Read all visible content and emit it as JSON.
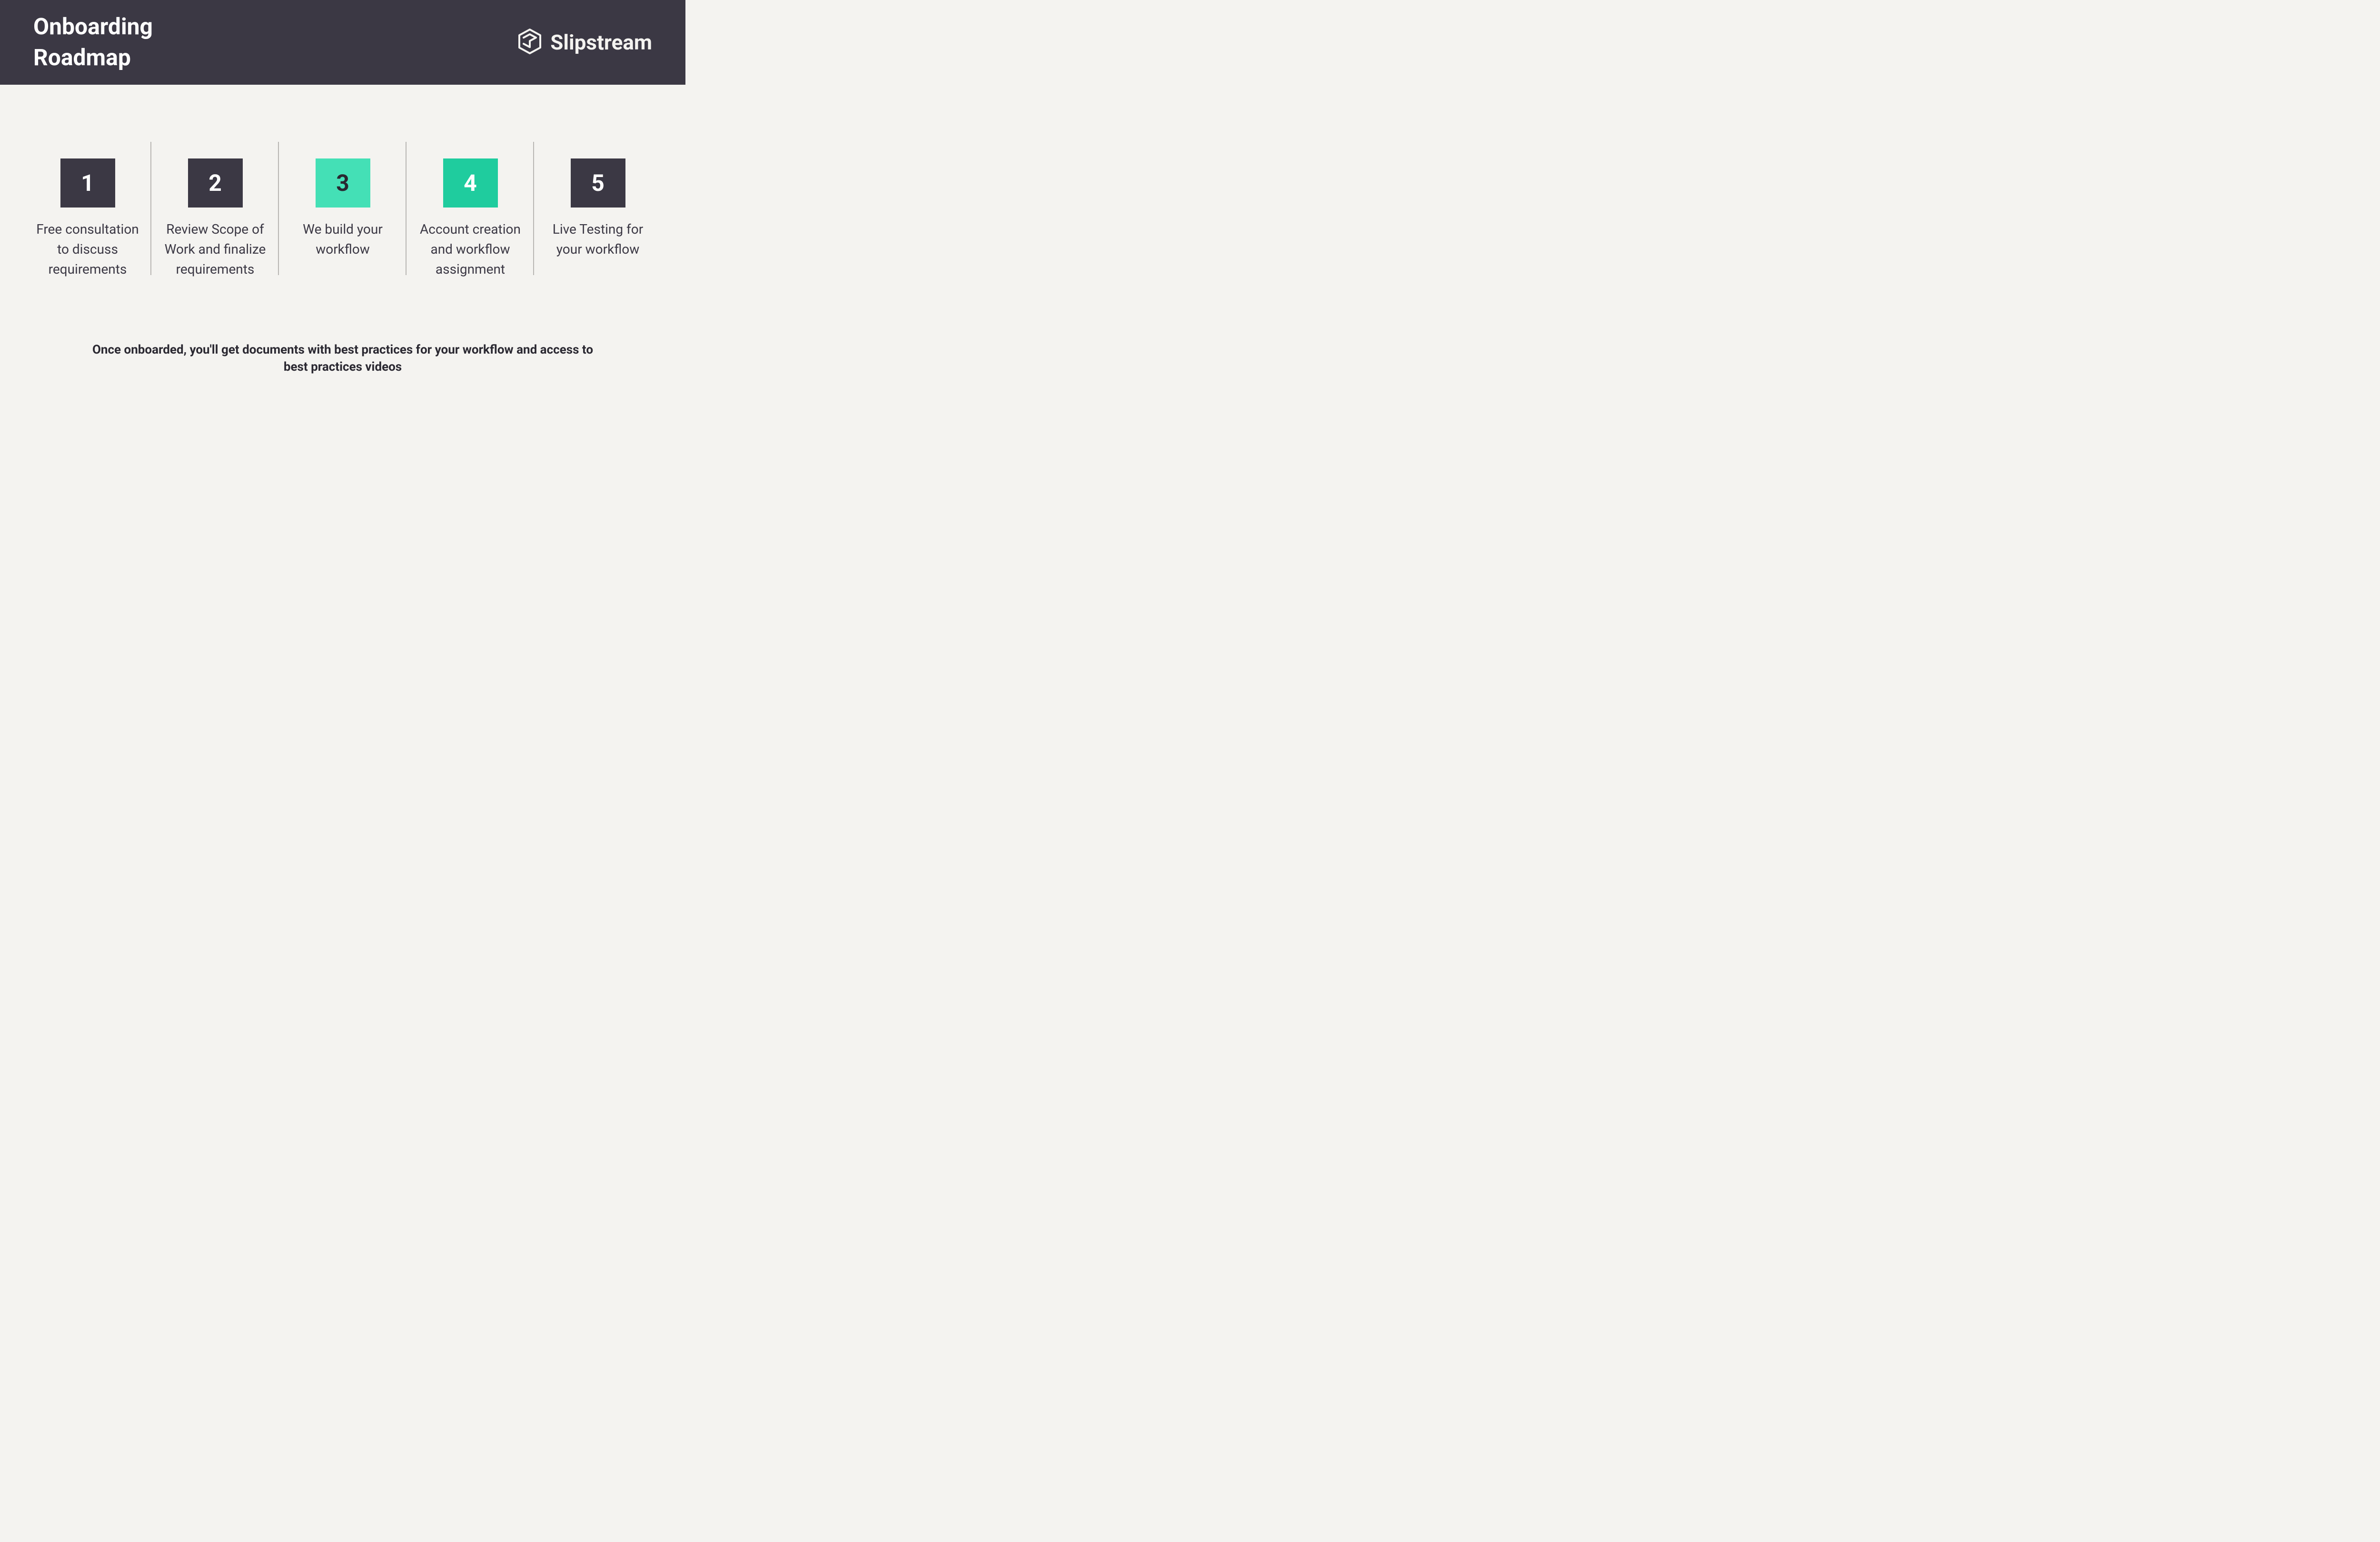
{
  "header": {
    "title_line1": "Onboarding",
    "title_line2": "Roadmap",
    "brand_name": "Slipstream"
  },
  "steps": {
    "s1": {
      "num": "1",
      "desc": "Free consultation to discuss requirements"
    },
    "s2": {
      "num": "2",
      "desc": "Review Scope of Work and finalize requirements"
    },
    "s3": {
      "num": "3",
      "desc": "We build your workflow"
    },
    "s4": {
      "num": "4",
      "desc": "Account creation and workflow assignment"
    },
    "s5": {
      "num": "5",
      "desc": "Live Testing for your workflow"
    }
  },
  "footer": "Once onboarded, you'll get documents with best practices for your workflow and access to best practices videos"
}
